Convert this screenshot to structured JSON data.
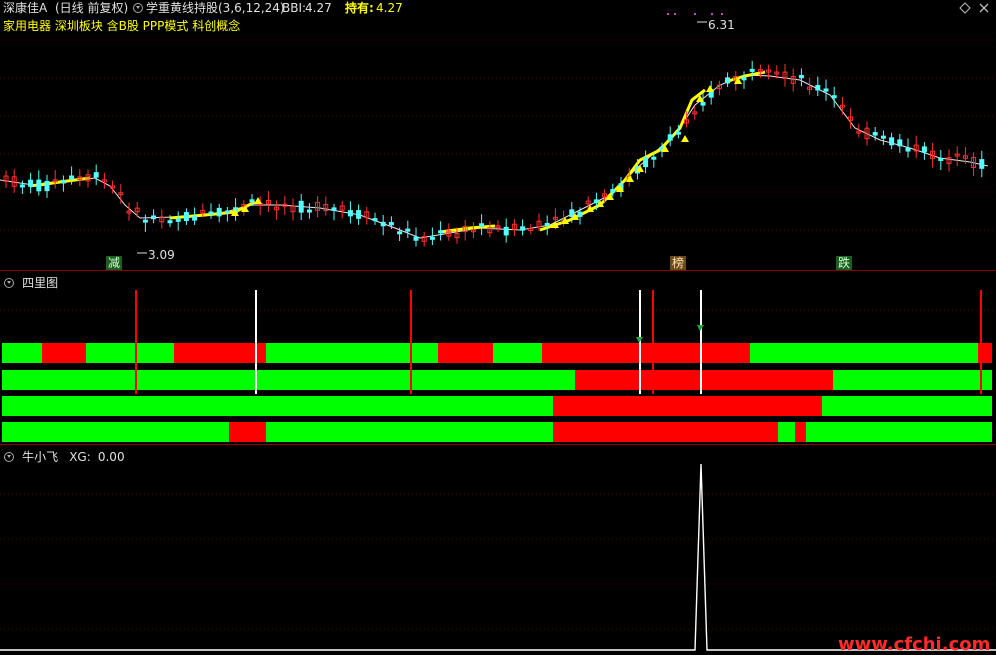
{
  "header": {
    "stock_name": "深康佳A",
    "period": "(日线 前复权)",
    "indicator": "学重黄线持股(3,6,12,24)",
    "bbi_label": "BBI:",
    "bbi_value": "4.27",
    "hold_label": "持有:",
    "hold_value": "4.27",
    "tags": "家用电器 深圳板块 含B股 PPP模式 科创概念"
  },
  "main_chart": {
    "high_label": "6.31",
    "low_label": "3.09",
    "marks": {
      "jian": "减",
      "bang": "榜",
      "die": "跌"
    },
    "colors": {
      "up": "#ff3030",
      "down": "#54ffff",
      "ma": "#e8e8e8",
      "hold_line": "#ffff00"
    }
  },
  "panel2": {
    "title": "四里图",
    "colors": {
      "green": "#00ff00",
      "red": "#ff0000",
      "white": "#ffffff"
    }
  },
  "panel3": {
    "title": "牛小飞",
    "xg_label": "XG:",
    "xg_value": "0.00"
  },
  "watermark": "www.cfchi.com",
  "icons": {
    "diamond": "diamond-icon",
    "close": "close-icon"
  }
}
